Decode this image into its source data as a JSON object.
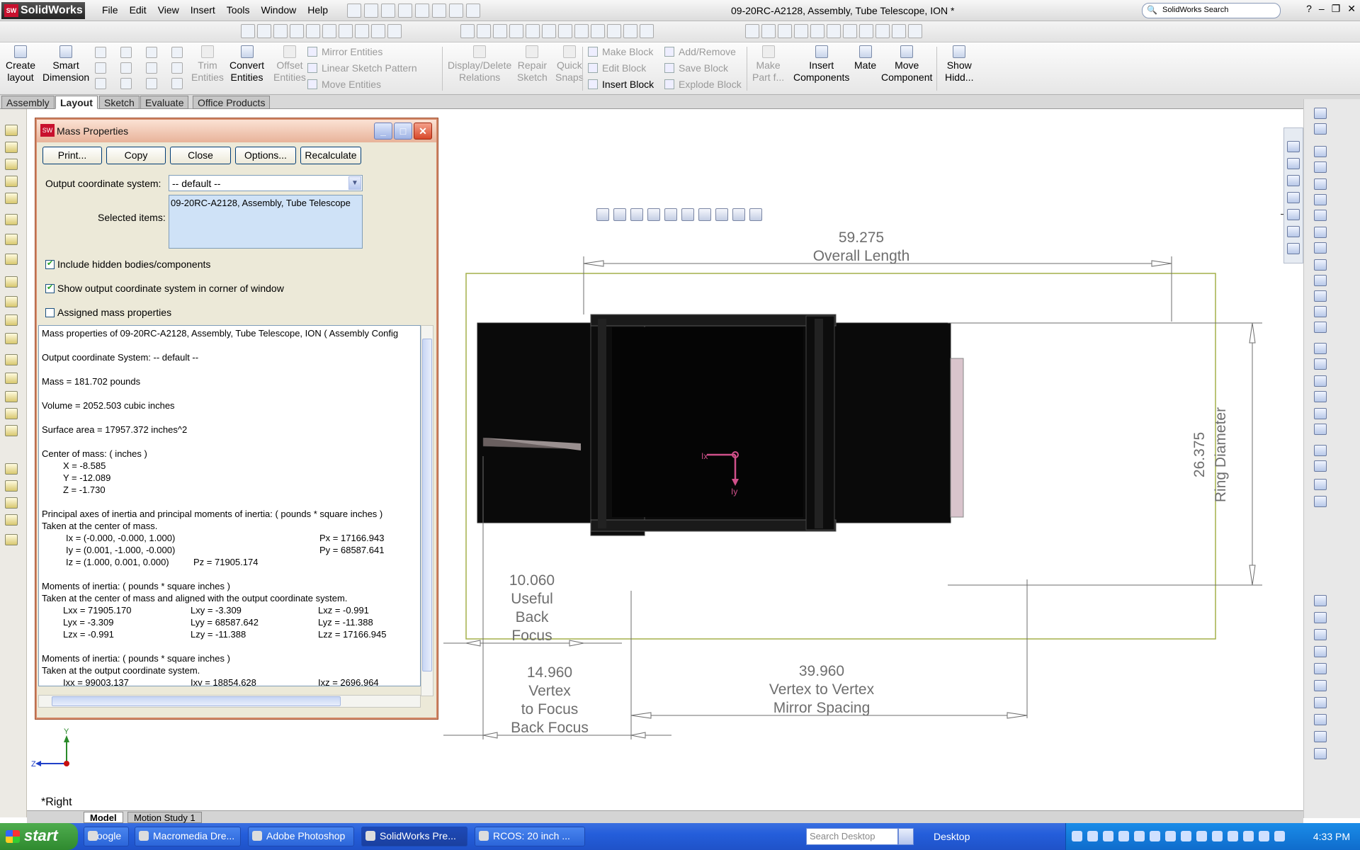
{
  "app": {
    "name": "SolidWorks",
    "menus": [
      "File",
      "Edit",
      "View",
      "Insert",
      "Tools",
      "Window",
      "Help"
    ],
    "document_title": "09-20RC-A2128, Assembly, Tube Telescope, ION *",
    "search_placeholder": "SolidWorks Search",
    "window_controls": [
      "?",
      "–",
      "❐",
      "✕"
    ]
  },
  "command_manager": {
    "large_commands": [
      {
        "label1": "Create",
        "label2": "layout",
        "enabled": true
      },
      {
        "label1": "Smart",
        "label2": "Dimension",
        "enabled": true
      },
      {
        "label1": "Trim",
        "label2": "Entities",
        "enabled": false
      },
      {
        "label1": "Convert",
        "label2": "Entities",
        "enabled": true
      },
      {
        "label1": "Offset",
        "label2": "Entities",
        "enabled": false
      },
      {
        "label1": "Display/Delete",
        "label2": "Relations",
        "enabled": false
      },
      {
        "label1": "Repair",
        "label2": "Sketch",
        "enabled": false
      },
      {
        "label1": "Quick",
        "label2": "Snaps",
        "enabled": false
      },
      {
        "label1": "Make",
        "label2": "Part f...",
        "enabled": false
      },
      {
        "label1": "Insert",
        "label2": "Components",
        "enabled": true
      },
      {
        "label1": "Mate",
        "label2": "",
        "enabled": true
      },
      {
        "label1": "Move",
        "label2": "Component",
        "enabled": true
      },
      {
        "label1": "Show",
        "label2": "Hidd...",
        "enabled": true
      }
    ],
    "small_commands": [
      {
        "label": "Mirror Entities",
        "enabled": false
      },
      {
        "label": "Linear Sketch Pattern",
        "enabled": false
      },
      {
        "label": "Move Entities",
        "enabled": false
      },
      {
        "label": "Make Block",
        "enabled": false
      },
      {
        "label": "Edit Block",
        "enabled": false
      },
      {
        "label": "Insert Block",
        "enabled": true
      },
      {
        "label": "Add/Remove",
        "enabled": false
      },
      {
        "label": "Save Block",
        "enabled": false
      },
      {
        "label": "Explode Block",
        "enabled": false
      }
    ],
    "tabs": [
      "Assembly",
      "Layout",
      "Sketch",
      "Evaluate",
      "Office Products"
    ],
    "active_tab": "Layout"
  },
  "mass_properties": {
    "title": "Mass Properties",
    "buttons": [
      "Print...",
      "Copy",
      "Close",
      "Options...",
      "Recalculate"
    ],
    "output_coord_label": "Output coordinate system:",
    "output_coord_value": "-- default --",
    "selected_items_label": "Selected items:",
    "selected_items_value": "09-20RC-A2128, Assembly, Tube Telescope",
    "checkboxes": [
      {
        "label": "Include hidden bodies/components",
        "checked": true
      },
      {
        "label": "Show output coordinate system in corner of window",
        "checked": true
      },
      {
        "label": "Assigned mass properties",
        "checked": false
      }
    ],
    "results": {
      "header": "Mass properties of 09-20RC-A2128, Assembly, Tube Telescope, ION ( Assembly Config",
      "output_system": "Output  coordinate System: -- default --",
      "mass": "Mass = 181.702 pounds",
      "volume": "Volume = 2052.503 cubic inches",
      "surface_area": "Surface area = 17957.372 inches^2",
      "com_header": "Center of mass: ( inches )",
      "com_x": "X = -8.585",
      "com_y": "Y = -12.089",
      "com_z": "Z = -1.730",
      "principal_header": "Principal axes of inertia and principal moments of inertia: ( pounds * square inches )",
      "principal_sub": "Taken at the center of mass.",
      "ix": "Ix = (-0.000, -0.000, 1.000)",
      "px": "Px = 17166.943",
      "iy": "Iy = (0.001, -1.000, -0.000)",
      "py": "Py = 68587.641",
      "iz": "Iz = (1.000, 0.001, 0.000)",
      "pz": "Pz = 71905.174",
      "moi_com_header": "Moments of inertia: ( pounds * square inches )",
      "moi_com_sub": "Taken at the center of mass and aligned with the output coordinate system.",
      "lxx": "Lxx = 71905.170",
      "lxy": "Lxy = -3.309",
      "lxz": "Lxz = -0.991",
      "lyx": "Lyx = -3.309",
      "lyy": "Lyy = 68587.642",
      "lyz": "Lyz = -11.388",
      "lzx": "Lzx = -0.991",
      "lzy": "Lzy = -11.388",
      "lzz": "Lzz = 17166.945",
      "moi_out_header": "Moments of inertia: ( pounds * square inches )",
      "moi_out_sub": "Taken at the output coordinate system.",
      "ixx": "Ixx = 99003.137",
      "ixy": "Ixy = 18854.628",
      "ixz": "Ixz = 2696.964"
    }
  },
  "drawing": {
    "overall_length_value": "59.275",
    "overall_length_label": "Overall Length",
    "ring_diameter_value": "26.375",
    "ring_diameter_label": "Ring Diameter",
    "useful_back_focus_value": "10.060",
    "useful_back_focus_l1": "Useful",
    "useful_back_focus_l2": "Back",
    "useful_back_focus_l3": "Focus",
    "vertex_focus_value": "14.960",
    "vertex_focus_l1": "Vertex",
    "vertex_focus_l2": "to Focus",
    "vertex_focus_l3": "Back Focus",
    "mirror_spacing_value": "39.960",
    "mirror_spacing_l1": "Vertex to Vertex",
    "mirror_spacing_l2": "Mirror Spacing",
    "triad_x": "Ix",
    "triad_y": "Iy",
    "corner_y": "Y",
    "corner_z": "Z",
    "view_name": "*Right"
  },
  "bottom_tabs": [
    "Model",
    "Motion Study 1"
  ],
  "taskbar": {
    "start": "start",
    "tasks": [
      "Google",
      "Macromedia Dre...",
      "Adobe Photoshop",
      "SolidWorks Pre...",
      "RCOS: 20 inch ..."
    ],
    "active_task": "SolidWorks Pre...",
    "search_placeholder": "Search Desktop",
    "desktop_label": "Desktop",
    "clock": "4:33 PM"
  },
  "colors": {
    "dimension_gray": "#6e6e6e",
    "triad_pink": "#d0508a",
    "axis_green": "#2a8a2a",
    "axis_blue": "#2040c8",
    "axis_red": "#c81010"
  }
}
